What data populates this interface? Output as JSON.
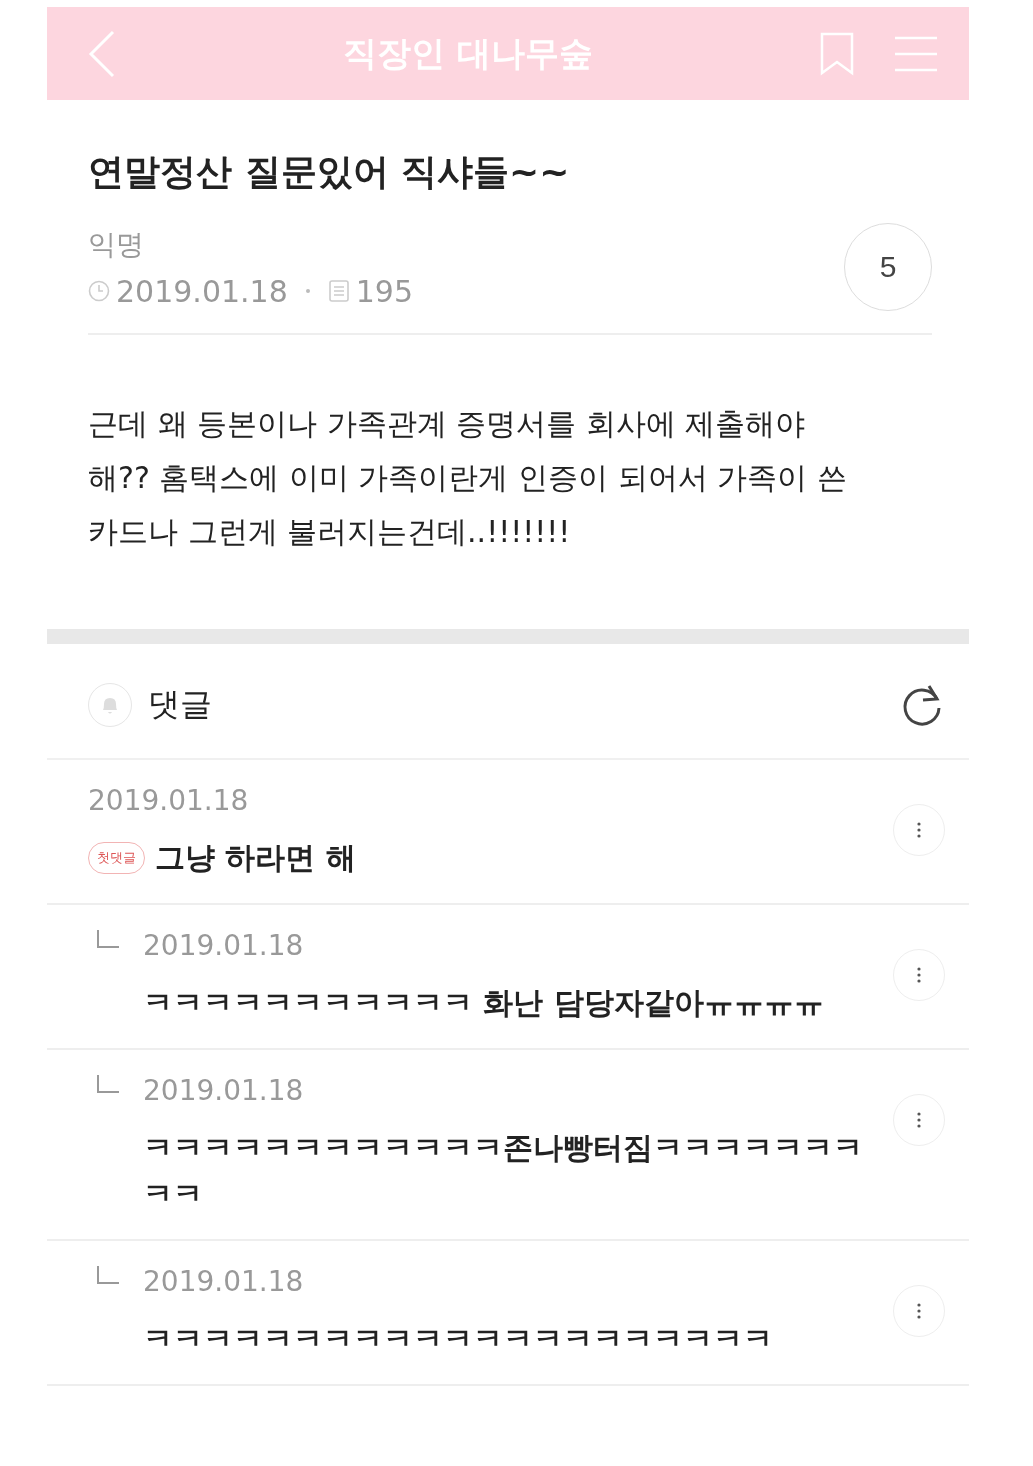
{
  "header": {
    "title": "직장인 대나무숲"
  },
  "post": {
    "title": "연말정산 질문있어 직샤들~~",
    "author": "익명",
    "date": "2019.01.18",
    "views": "195",
    "comment_count": "5",
    "body": "근데 왜 등본이나 가족관계 증명서를 회사에 제출해야 해?? 홈택스에 이미 가족이란게 인증이 되어서 가족이 쓴 카드나 그런게 불러지는건데..!!!!!!!"
  },
  "comments_header": {
    "label": "댓글"
  },
  "comments": [
    {
      "kind": "comment",
      "date": "2019.01.18",
      "badge": "첫댓글",
      "text": "그냥 하라면 해"
    },
    {
      "kind": "reply",
      "date": "2019.01.18",
      "text": "ㅋㅋㅋㅋㅋㅋㅋㅋㅋㅋㅋ 화난 담당자같아ㅠㅠㅠㅠ"
    },
    {
      "kind": "reply",
      "date": "2019.01.18",
      "text": "ㅋㅋㅋㅋㅋㅋㅋㅋㅋㅋㅋㅋ존나빵터짐ㅋㅋㅋㅋㅋㅋㅋㅋㅋ"
    },
    {
      "kind": "reply",
      "date": "2019.01.18",
      "text": "ㅋㅋㅋㅋㅋㅋㅋㅋㅋㅋㅋㅋㅋㅋㅋㅋㅋㅋㅋㅋㅋ"
    }
  ]
}
